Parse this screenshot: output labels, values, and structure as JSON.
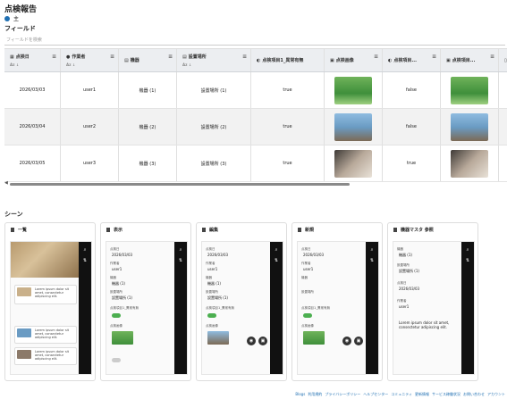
{
  "page_title": "点検報告",
  "tab": {
    "label": "主"
  },
  "fields_section": {
    "label": "フィールド",
    "search_placeholder": "フィールドを検索"
  },
  "table": {
    "columns": [
      {
        "label": "点検日",
        "icon": "calendar-icon",
        "sub": "Az ↓"
      },
      {
        "label": "作業者",
        "icon": "user-icon",
        "sub": "Az ↓"
      },
      {
        "label": "機器",
        "icon": "ref-icon",
        "sub": ""
      },
      {
        "label": "設置場所",
        "icon": "ref-icon",
        "sub": "Az ↓"
      },
      {
        "label": "点検項目1_異常有無",
        "icon": "toggle-icon",
        "sub": ""
      },
      {
        "label": "点検画像",
        "icon": "image-icon",
        "sub": ""
      },
      {
        "label": "点検項目...",
        "icon": "toggle-icon",
        "sub": ""
      },
      {
        "label": "点検項目...",
        "icon": "image-icon",
        "sub": ""
      },
      {
        "label": "点",
        "icon": "doc-icon",
        "sub": ""
      }
    ],
    "rows": [
      {
        "date": "2026/03/03",
        "worker": "user1",
        "device": "機器 (1)",
        "place": "設置場所 (1)",
        "flag1": "true",
        "img1": "green",
        "flag2": "false",
        "img2": "green"
      },
      {
        "date": "2026/03/04",
        "worker": "user2",
        "device": "機器 (2)",
        "place": "設置場所 (2)",
        "flag1": "true",
        "img1": "sky",
        "flag2": "false",
        "img2": "sky"
      },
      {
        "date": "2026/03/05",
        "worker": "user3",
        "device": "機器 (3)",
        "place": "設置場所 (3)",
        "flag1": "true",
        "img1": "dark",
        "flag2": "true",
        "img2": "dark"
      }
    ]
  },
  "scenes_section": {
    "label": "シーン"
  },
  "scenes": [
    {
      "title": "一覧"
    },
    {
      "title": "表示"
    },
    {
      "title": "編集"
    },
    {
      "title": "新規"
    },
    {
      "title": "機器マスタ 参照"
    }
  ],
  "scene_fields": {
    "date_label": "点検日",
    "date_value": "2026/03/03",
    "worker_label": "作業者",
    "worker_value": "user1",
    "device_label": "機器",
    "device_value": "機器 (1)",
    "place_label": "設置場所",
    "place_value": "設置場所 (1)",
    "flag_label": "点検項目1_異常有無",
    "image_label": "点検画像",
    "lorem": "Lorem ipsum dolor sit amet, consectetur adipiscing elit."
  },
  "footer_links": [
    "Blogs",
    "利用規約",
    "プライバシーポリシー",
    "ヘルプセンター",
    "コミュニティ",
    "更新情報",
    "サービス稼働状況",
    "お問い合わせ",
    "アカウント"
  ]
}
